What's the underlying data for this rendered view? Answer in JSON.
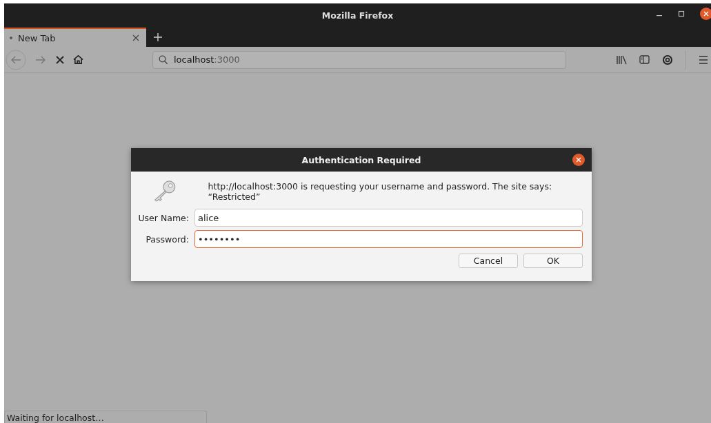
{
  "window": {
    "title": "Mozilla Firefox"
  },
  "tabs": [
    {
      "label": "New Tab",
      "loading": true,
      "selected": true
    }
  ],
  "address_bar": {
    "host": "localhost",
    "port": ":3000"
  },
  "dialog": {
    "title": "Authentication Required",
    "message": "http://localhost:3000 is requesting your username and password. The site says: “Restricted”",
    "fields": [
      {
        "label": "User Name:",
        "value": "alice",
        "focused": false
      },
      {
        "label": "Password:",
        "value": "••••••••",
        "focused": true
      }
    ],
    "buttons": [
      "Cancel",
      "OK"
    ]
  },
  "status_bar": {
    "text": "Waiting for localhost…"
  }
}
